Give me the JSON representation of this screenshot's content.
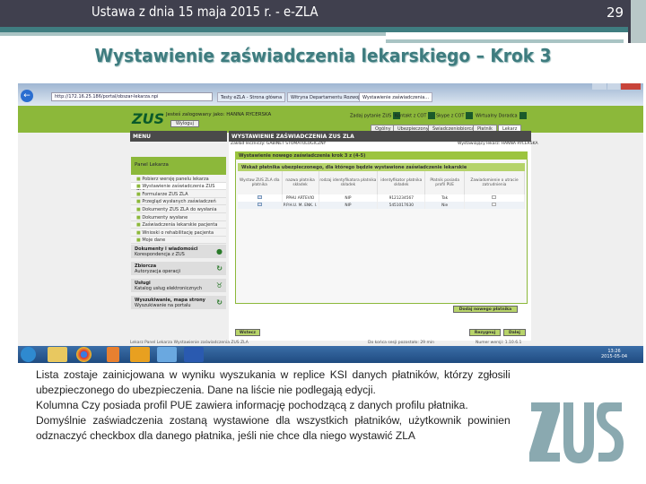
{
  "slide": {
    "header": "Ustawa z dnia 15 maja 2015 r. - e-ZLA",
    "page_number": "29",
    "title": "Wystawienie zaświadczenia lekarskiego – Krok 3",
    "colors": {
      "header_bg": "#40404e",
      "accent": "#3e7c7f",
      "zus_logo": "#8aa9b0"
    },
    "description": [
      "Lista zostaje zainicjowana w wyniku wyszukania w replice KSI danych płatników, którzy zgłosili ubezpieczonego do ubezpieczenia. Dane na liście nie podlegają edycji.",
      "Kolumna Czy posiada profil PUE zawiera informację pochodzącą z danych profilu płatnika.",
      "Domyślnie zaświadczenia zostaną wystawione dla wszystkich płatników, użytkownik powinien odznaczyć checkbox dla danego płatnika, jeśli nie chce dla niego wystawić ZLA"
    ],
    "logo_text": "ZUS"
  },
  "screenshot": {
    "browser": {
      "url": "http://172.16.25.186/portal/obszar-lekarza.npi",
      "tabs": [
        "Testy eZLA - Strona główna",
        "Witryna Departamentu Rozwoj...",
        "Wystawienie zaświadczenia..."
      ]
    },
    "site": {
      "logo": "ZUS",
      "logged_in": "Jesteś zalogowany jako: HANNA RYCERSKA",
      "logout": "Wyloguj",
      "tools": [
        "Zadaj pytanie ZUS",
        "Kontakt z COT",
        "Skype z COT",
        "Wirtualny Doradca"
      ],
      "nav_tabs": [
        "Ogólny",
        "Ubezpieczony",
        "Świadczeniobiorca",
        "Płatnik",
        "Lekarz"
      ],
      "menu_title": "MENU",
      "panel": "Panel Lekarza",
      "menu_items": [
        "Pobierz wersję panelu lekarza",
        "Wystawienie zaświadczenia ZUS ZLA",
        "Formularze ZUS ZLA",
        "Przegląd wysłanych zaświadczeń",
        "Dokumenty ZUS ZLA do wysłania",
        "Dokumenty wysłane",
        "Zaświadczenia lekarskie pacjenta",
        "Wnioski o rehabilitację pacjenta",
        "Moje dane"
      ],
      "groups": [
        {
          "title": "Dokumenty i wiadomości",
          "sub": "Korespondencja z ZUS",
          "icon": "chat-icon"
        },
        {
          "title": "Zbiorcza",
          "sub": "Autoryzacja operacji",
          "icon": "refresh-icon"
        },
        {
          "title": "Usługi",
          "sub": "Katalog usług elektronicznych",
          "icon": "services-icon"
        },
        {
          "title": "Wyszukiwanie, mapa strony",
          "sub": "Wyszukiwanie na portalu",
          "icon": "search-refresh-icon"
        }
      ],
      "main_title": "WYSTAWIENIE ZAŚWIADCZENIA ZUS ZLA",
      "facility": "Zakład leczniczy: GABINET STOMATOLOGICZNY",
      "doctor": "Wystawiający lekarz: HANNA RYCERSKA",
      "step": "Wystawienie nowego zaświadczenia krok 3 z (4-5)",
      "section": "Wskaż płatnika ubezpieczonego, dla którego będzie wystawione zaświadczenie lekarskie",
      "columns": [
        "Wystaw ZUS ZLA dla płatnika",
        "nazwa płatnika składek",
        "rodzaj identyfikatora płatnika składek",
        "identyfikator płatnika składek",
        "Płatnik posiada profil PUE",
        "Zawiadomienie o utracie zatrudnienia"
      ],
      "rows": [
        {
          "checked": true,
          "name": "PPHU ARTEVIO",
          "id_type": "NIP",
          "id": "9121234567",
          "pue": "Tak",
          "notify": false
        },
        {
          "checked": true,
          "name": "P.P.H.U. M. ENK. I.",
          "id_type": "NIP",
          "id": "5451017630",
          "pue": "Nie",
          "notify": false
        }
      ],
      "add_payer": "Dodaj nowego płatnika",
      "back": "Wstecz",
      "cancel": "Rezygnuj",
      "next": "Dalej",
      "breadcrumb": "Lekarz  Panel Lekarza  Wystawienie zaświadczenia ZUS ZLA",
      "session": "Do końca sesji pozostało: 29 min",
      "version": "Numer wersji: 1.10.6.1",
      "colors": {
        "green": "#8cb83a",
        "dark": "#4a4a4a"
      }
    },
    "taskbar": {
      "time": "13:26",
      "date": "2015-05-04"
    }
  }
}
